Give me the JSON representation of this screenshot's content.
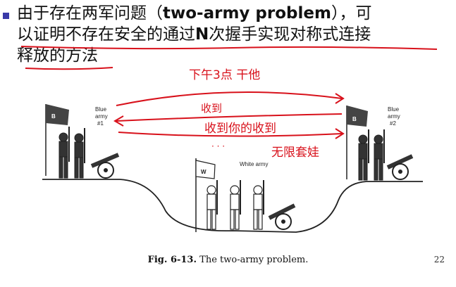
{
  "slide": {
    "heading_line1_a": "由于存在两军问题（",
    "heading_line1_bold": "two-army problem",
    "heading_line1_b": "），可",
    "heading_line2_a": "以证明不存在安全的通过",
    "heading_line2_bold": "N",
    "heading_line2_b": "次握手实现对称式连接",
    "heading_line3": "释放的方法",
    "page_number": "22"
  },
  "figure": {
    "blue_army_1": [
      "Blue",
      "army",
      "#1"
    ],
    "blue_army_2": [
      "Blue",
      "army",
      "#2"
    ],
    "white_army": "White army",
    "flag_b": "B",
    "flag_w": "W",
    "caption_bold": "Fig.  6-13.",
    "caption_rest": " The two-army problem."
  },
  "annotations": {
    "note_top": "下午3点 干他",
    "note_received": "收到",
    "note_received_yours": "收到你的收到",
    "note_dots": "· · ·",
    "note_endless": "无限套娃",
    "ink_color": "#d8111b"
  }
}
